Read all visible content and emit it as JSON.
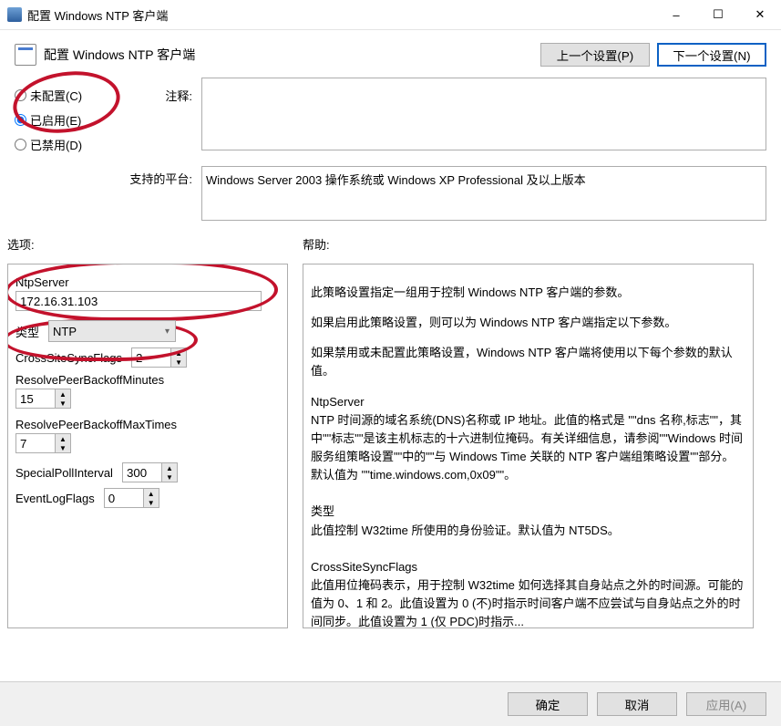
{
  "window": {
    "title": "配置 Windows NTP 客户端"
  },
  "sysbuttons": {
    "minimize": "–",
    "maximize": "☐",
    "close": "✕"
  },
  "header": {
    "setting_name": "配置 Windows NTP 客户端",
    "prev_setting": "上一个设置(P)",
    "next_setting": "下一个设置(N)"
  },
  "state": {
    "not_configured_label": "未配置(C)",
    "enabled_label": "已启用(E)",
    "disabled_label": "已禁用(D)",
    "selected": "enabled"
  },
  "labels": {
    "comment": "注释:",
    "supported_on": "支持的平台:",
    "options": "选项:",
    "help": "帮助:"
  },
  "comment": "",
  "supported_on_text": "Windows Server 2003 操作系统或 Windows XP Professional 及以上版本",
  "options": {
    "ntpserver_label": "NtpServer",
    "ntpserver_value": "172.16.31.103",
    "type_label": "类型",
    "type_value": "NTP",
    "crosssite_label": "CrossSiteSyncFlags",
    "crosssite_value": "2",
    "resolve_backoff_min_label": "ResolvePeerBackoffMinutes",
    "resolve_backoff_min_value": "15",
    "resolve_backoff_max_label": "ResolvePeerBackoffMaxTimes",
    "resolve_backoff_max_value": "7",
    "special_poll_label": "SpecialPollInterval",
    "special_poll_value": "300",
    "eventlog_label": "EventLogFlags",
    "eventlog_value": "0"
  },
  "help_text": {
    "p1": "此策略设置指定一组用于控制 Windows NTP 客户端的参数。",
    "p2": "如果启用此策略设置，则可以为 Windows NTP 客户端指定以下参数。",
    "p3": "如果禁用或未配置此策略设置，Windows NTP 客户端将使用以下每个参数的默认值。",
    "h1": "NtpServer",
    "p4": "NTP 时间源的域名系统(DNS)名称或 IP 地址。此值的格式是 \"\"dns 名称,标志\"\"，其中\"\"标志\"\"是该主机标志的十六进制位掩码。有关详细信息，请参阅\"\"Windows 时间服务组策略设置\"\"中的\"\"与 Windows Time 关联的 NTP 客户端组策略设置\"\"部分。默认值为 \"\"time.windows.com,0x09\"\"。",
    "h2": "类型",
    "p5": "此值控制 W32time 所使用的身份验证。默认值为 NT5DS。",
    "h3": "CrossSiteSyncFlags",
    "p6": "此值用位掩码表示，用于控制 W32time 如何选择其自身站点之外的时间源。可能的值为 0、1 和 2。此值设置为 0 (不)时指示时间客户端不应尝试与自身站点之外的时间同步。此值设置为 1 (仅 PDC)时指示..."
  },
  "footer": {
    "ok": "确定",
    "cancel": "取消",
    "apply": "应用(A)"
  }
}
